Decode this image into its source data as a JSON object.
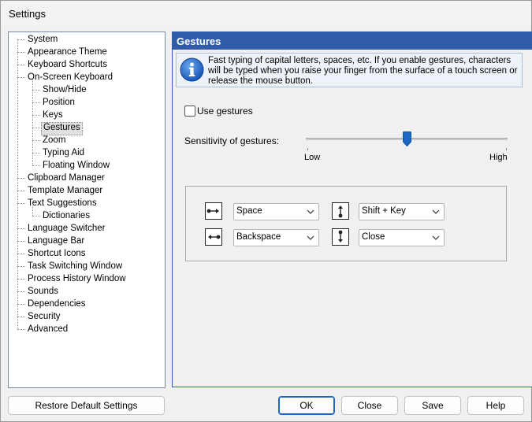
{
  "window": {
    "title": "Settings"
  },
  "tree": {
    "items": [
      {
        "label": "System",
        "level": 0
      },
      {
        "label": "Appearance Theme",
        "level": 0
      },
      {
        "label": "Keyboard Shortcuts",
        "level": 0
      },
      {
        "label": "On-Screen Keyboard",
        "level": 0
      },
      {
        "label": "Show/Hide",
        "level": 1
      },
      {
        "label": "Position",
        "level": 1
      },
      {
        "label": "Keys",
        "level": 1
      },
      {
        "label": "Gestures",
        "level": 1,
        "selected": true
      },
      {
        "label": "Zoom",
        "level": 1
      },
      {
        "label": "Typing Aid",
        "level": 1
      },
      {
        "label": "Floating Window",
        "level": 1
      },
      {
        "label": "Clipboard Manager",
        "level": 0
      },
      {
        "label": "Template Manager",
        "level": 0
      },
      {
        "label": "Text Suggestions",
        "level": 0
      },
      {
        "label": "Dictionaries",
        "level": 1
      },
      {
        "label": "Language Switcher",
        "level": 0
      },
      {
        "label": "Language Bar",
        "level": 0
      },
      {
        "label": "Shortcut Icons",
        "level": 0
      },
      {
        "label": "Task Switching Window",
        "level": 0
      },
      {
        "label": "Process History Window",
        "level": 0
      },
      {
        "label": "Sounds",
        "level": 0
      },
      {
        "label": "Dependencies",
        "level": 0
      },
      {
        "label": "Security",
        "level": 0
      },
      {
        "label": "Advanced",
        "level": 0
      }
    ]
  },
  "panel": {
    "title": "Gestures",
    "info_text": "Fast typing of capital letters, spaces, etc. If you enable gestures, characters will be typed when you raise your finger from the surface of a touch screen or release the mouse button.",
    "use_gestures_label": "Use gestures",
    "use_gestures_checked": false,
    "sensitivity_label": "Sensitivity of gestures:",
    "sensitivity_low": "Low",
    "sensitivity_high": "High",
    "sensitivity_value": 0.5,
    "gestures": {
      "right": {
        "icon": "swipe-right-icon",
        "value": "Space"
      },
      "left": {
        "icon": "swipe-left-icon",
        "value": "Backspace"
      },
      "up": {
        "icon": "swipe-up-icon",
        "value": "Shift + Key"
      },
      "down": {
        "icon": "swipe-down-icon",
        "value": "Close"
      }
    }
  },
  "buttons": {
    "restore": "Restore Default Settings",
    "ok": "OK",
    "close": "Close",
    "save": "Save",
    "help": "Help"
  },
  "colors": {
    "header_bg": "#2f5ba8",
    "accent": "#1f67c4"
  }
}
